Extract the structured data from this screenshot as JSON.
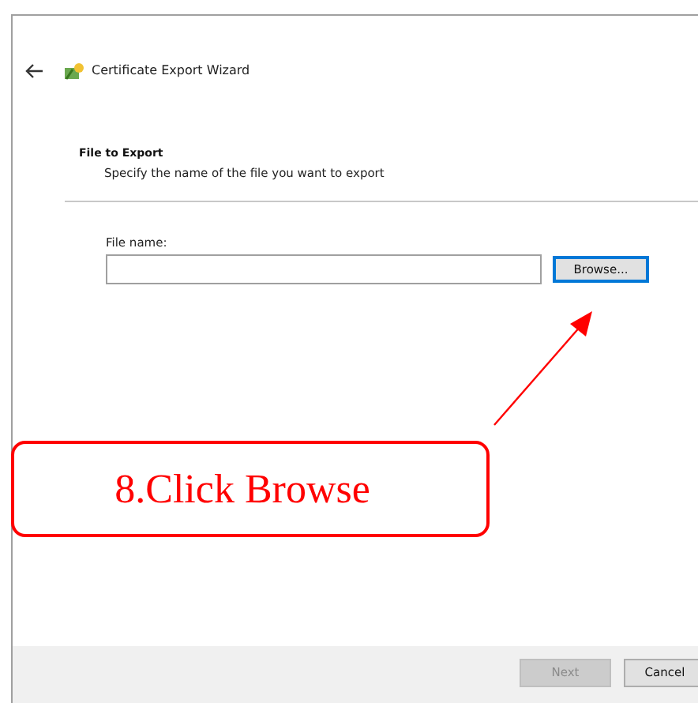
{
  "window": {
    "title": "Certificate Export Wizard"
  },
  "section": {
    "heading": "File to Export",
    "description": "Specify the name of the file you want to export"
  },
  "file_field": {
    "label": "File name:",
    "browse_button": {
      "label": "Browse...",
      "focused": true
    }
  },
  "annotation": {
    "text": "8.Click Browse"
  },
  "footer_buttons": [
    {
      "label": "Next",
      "disabled": true
    },
    {
      "label": "Cancel",
      "disabled": false
    }
  ]
}
